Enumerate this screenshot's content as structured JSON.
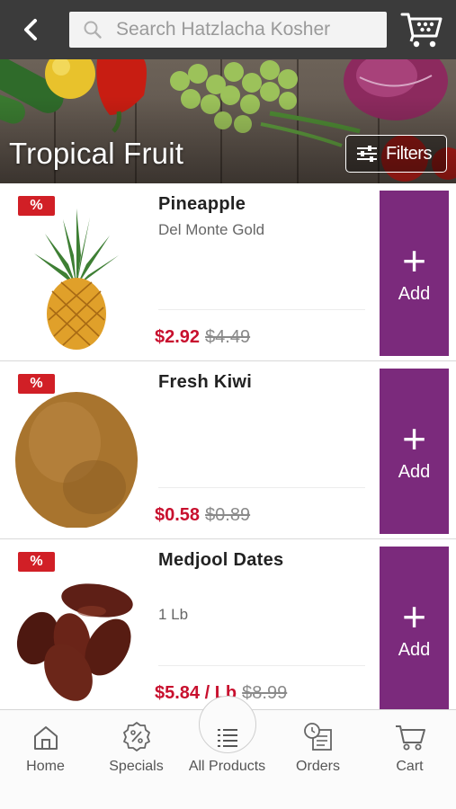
{
  "header": {
    "search_placeholder": "Search Hatzlacha Kosher"
  },
  "hero": {
    "title": "Tropical Fruit",
    "filters_label": "Filters"
  },
  "products": [
    {
      "badge": "%",
      "name": "Pineapple",
      "subtitle": "Del Monte Gold",
      "price": "$2.92",
      "old_price": "$4.49",
      "add_label": "Add"
    },
    {
      "badge": "%",
      "name": "Fresh Kiwi",
      "subtitle": "",
      "price": "$0.58",
      "old_price": "$0.89",
      "add_label": "Add"
    },
    {
      "badge": "%",
      "name": "Medjool Dates",
      "subtitle": "1 Lb",
      "price": "$5.84 / Lb",
      "old_price": "$8.99",
      "add_label": "Add"
    }
  ],
  "nav": {
    "items": [
      {
        "label": "Home",
        "icon": "home-icon"
      },
      {
        "label": "Specials",
        "icon": "specials-icon"
      },
      {
        "label": "All Products",
        "icon": "list-icon"
      },
      {
        "label": "Orders",
        "icon": "orders-icon"
      },
      {
        "label": "Cart",
        "icon": "cart-icon"
      }
    ]
  },
  "colors": {
    "topbar": "#3b3b3b",
    "accent_purple": "#7b2a7c",
    "sale_red": "#d11f26",
    "price_red": "#c8102e"
  }
}
